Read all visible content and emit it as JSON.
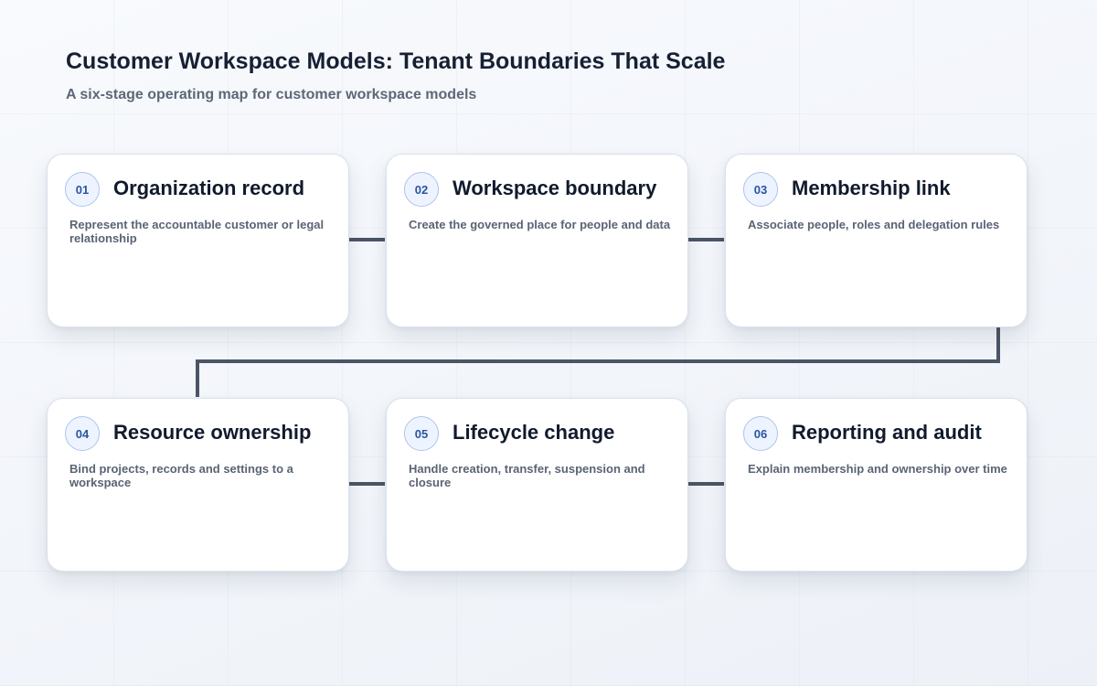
{
  "header": {
    "title": "Customer Workspace Models: Tenant Boundaries That Scale",
    "subtitle": "A six-stage operating map for customer workspace models"
  },
  "stages": [
    {
      "number": "01",
      "title": "Organization record",
      "description": "Represent the accountable customer or legal relationship"
    },
    {
      "number": "02",
      "title": "Workspace boundary",
      "description": "Create the governed place for people and data"
    },
    {
      "number": "03",
      "title": "Membership link",
      "description": "Associate people, roles and delegation rules"
    },
    {
      "number": "04",
      "title": "Resource ownership",
      "description": "Bind projects, records and settings to a workspace"
    },
    {
      "number": "05",
      "title": "Lifecycle change",
      "description": "Handle creation, transfer, suspension and closure"
    },
    {
      "number": "06",
      "title": "Reporting and audit",
      "description": "Explain membership and ownership over time"
    }
  ],
  "style": {
    "connector_color": "#4b5566",
    "badge_color": "#2855a4",
    "title_color": "#111a2d",
    "card_background": "#ffffff"
  }
}
